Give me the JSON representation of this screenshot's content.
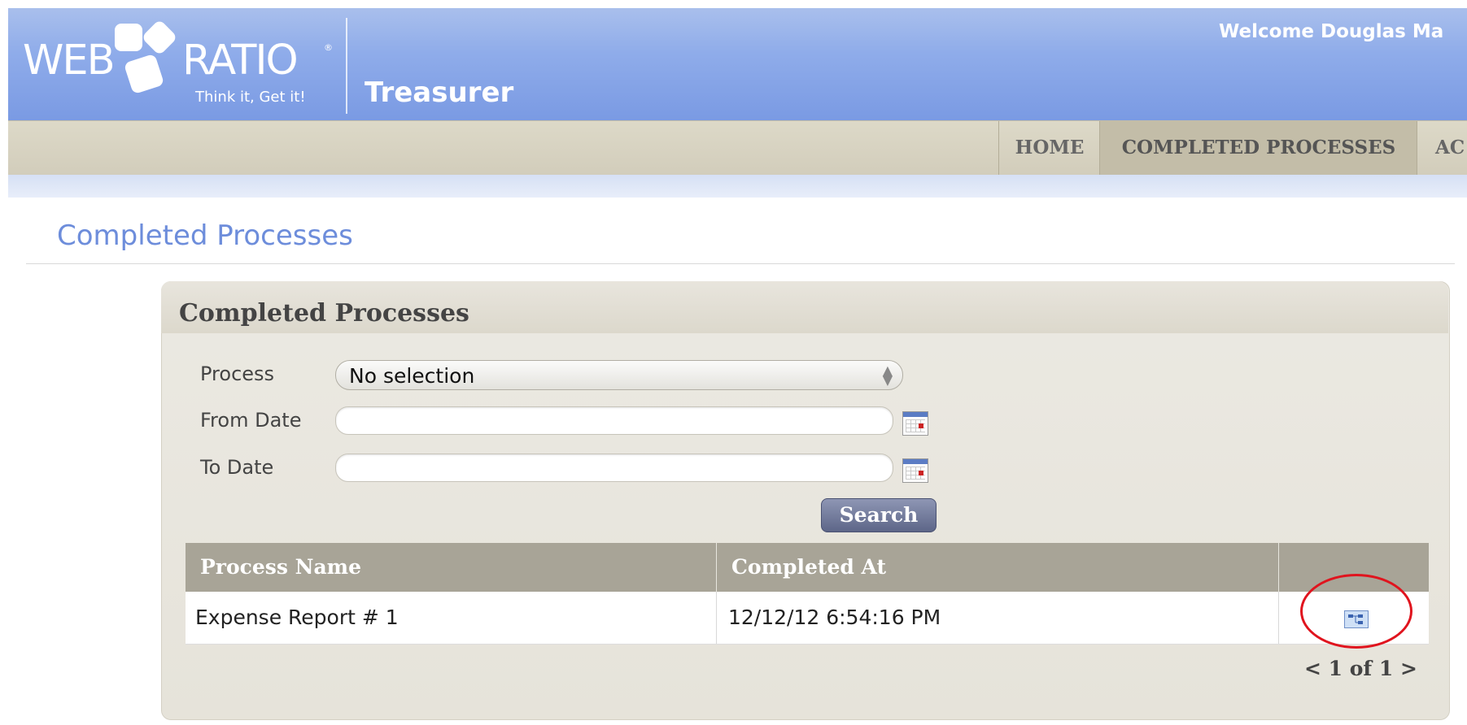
{
  "header": {
    "logo": {
      "word_left": "WEB",
      "word_right": "RATIO",
      "registered": "®",
      "tagline": "Think it, Get it!"
    },
    "app_title": "Treasurer",
    "welcome": "Welcome Douglas Ma"
  },
  "nav": {
    "items": [
      {
        "label": "HOME"
      },
      {
        "label": "COMPLETED PROCESSES"
      },
      {
        "label": "AC"
      }
    ],
    "active_index": 1
  },
  "page": {
    "title": "Completed Processes"
  },
  "panel": {
    "title": "Completed Processes",
    "filters": {
      "process_label": "Process",
      "process_selected": "No selection",
      "from_label": "From Date",
      "from_value": "",
      "to_label": "To Date",
      "to_value": ""
    },
    "search_label": "Search",
    "table": {
      "columns": [
        "Process Name",
        "Completed At",
        ""
      ],
      "rows": [
        {
          "process_name": "Expense Report # 1",
          "completed_at": "12/12/12 6:54:16 PM",
          "action_icon": "process-diagram-icon"
        }
      ]
    },
    "pagination": "< 1 of 1 >"
  },
  "colors": {
    "header_blue": "#8facea",
    "nav_beige": "#d2cdbb",
    "title_blue": "#6d8ddb",
    "table_head": "#a8a497",
    "highlight_red": "#e0141e"
  }
}
